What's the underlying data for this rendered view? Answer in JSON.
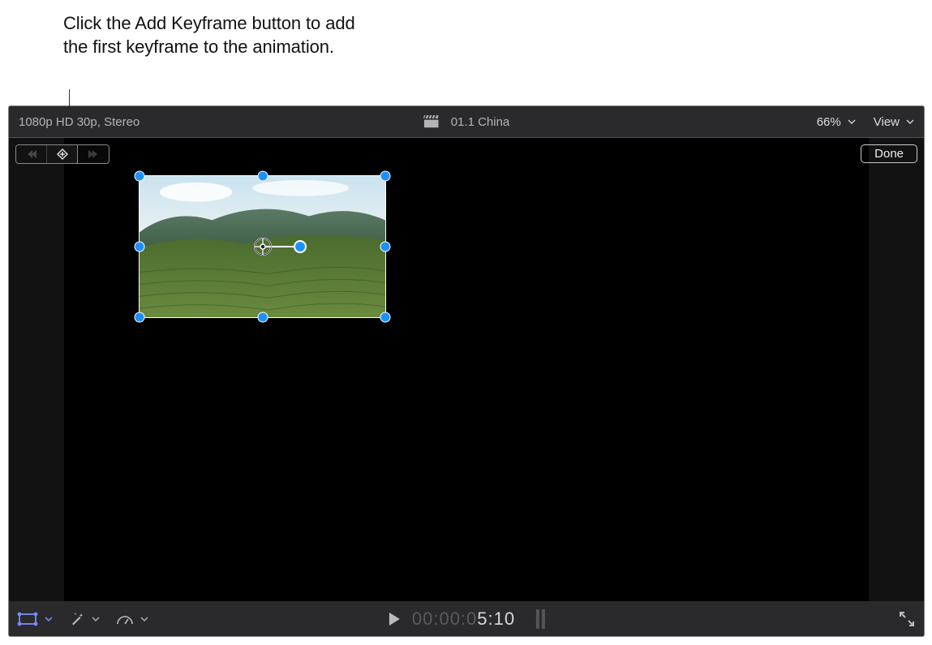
{
  "callout": {
    "text": "Click the Add Keyframe button to add the first keyframe to the animation."
  },
  "toolbar": {
    "format_info": "1080p HD 30p, Stereo",
    "clip_name": "01.1 China",
    "zoom_label": "66%",
    "view_label": "View"
  },
  "viewer": {
    "done_label": "Done"
  },
  "bottom": {
    "timecode_dim": "00:00:0",
    "timecode_active": "5:10"
  }
}
